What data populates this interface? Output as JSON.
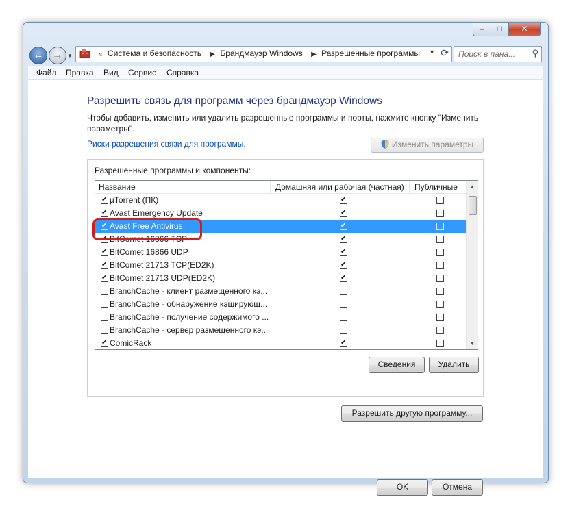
{
  "address_bar": {
    "crumbs": [
      "Система и безопасность",
      "Брандмауэр Windows",
      "Разрешенные программы"
    ]
  },
  "search": {
    "placeholder": "Поиск в пана..."
  },
  "window_controls": {
    "minimize": "–",
    "maximize": "□",
    "close": "✕"
  },
  "menu": [
    "Файл",
    "Правка",
    "Вид",
    "Сервис",
    "Справка"
  ],
  "page": {
    "title": "Разрешить связь для программ через брандмауэр Windows",
    "description": "Чтобы добавить, изменить или удалить разрешенные программы и порты, нажмите кнопку \"Изменить параметры\".",
    "risk_link": "Риски разрешения связи для программы.",
    "change_settings_button": "Изменить параметры",
    "group_label": "Разрешенные программы и компоненты:"
  },
  "list": {
    "columns": {
      "name": "Название",
      "home": "Домашняя или рабочая (частная)",
      "public": "Публичные"
    },
    "rows": [
      {
        "name": "µTorrent (ПК)",
        "enabled": true,
        "home": true,
        "public": false,
        "selected": false
      },
      {
        "name": "Avast Emergency Update",
        "enabled": true,
        "home": true,
        "public": false,
        "selected": false
      },
      {
        "name": "Avast Free Antivirus",
        "enabled": true,
        "home": true,
        "public": false,
        "selected": true
      },
      {
        "name": "BitComet 16866 TCP",
        "enabled": true,
        "home": true,
        "public": false,
        "selected": false
      },
      {
        "name": "BitComet 16866 UDP",
        "enabled": true,
        "home": true,
        "public": false,
        "selected": false
      },
      {
        "name": "BitComet 21713 TCP(ED2K)",
        "enabled": true,
        "home": true,
        "public": false,
        "selected": false
      },
      {
        "name": "BitComet 21713 UDP(ED2K)",
        "enabled": true,
        "home": true,
        "public": false,
        "selected": false
      },
      {
        "name": "BranchCache - клиент размещенного кэ...",
        "enabled": false,
        "home": false,
        "public": false,
        "selected": false
      },
      {
        "name": "BranchCache - обнаружение кэширующ...",
        "enabled": false,
        "home": false,
        "public": false,
        "selected": false
      },
      {
        "name": "BranchCache - получение содержимого ...",
        "enabled": false,
        "home": false,
        "public": false,
        "selected": false
      },
      {
        "name": "BranchCache - сервер размещенного кэ...",
        "enabled": false,
        "home": false,
        "public": false,
        "selected": false
      },
      {
        "name": "ComicRack",
        "enabled": true,
        "home": true,
        "public": false,
        "selected": false
      }
    ]
  },
  "buttons": {
    "details": "Сведения",
    "remove": "Удалить",
    "allow_other": "Разрешить другую программу...",
    "ok": "OK",
    "cancel": "Отмена"
  },
  "colors": {
    "selection": "#3399ff",
    "highlight_ring": "#d0201c",
    "title": "#1e3287",
    "link": "#0a4cb5"
  }
}
